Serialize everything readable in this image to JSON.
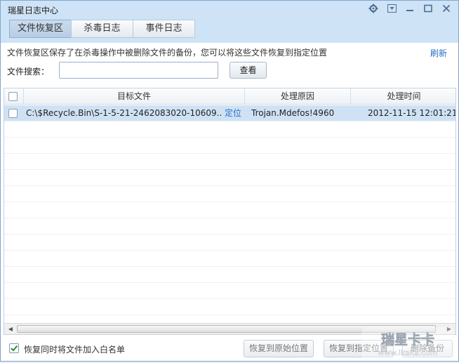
{
  "window": {
    "title": "瑞星日志中心"
  },
  "tabs": [
    {
      "label": "文件恢复区",
      "active": true
    },
    {
      "label": "杀毒日志",
      "active": false
    },
    {
      "label": "事件日志",
      "active": false
    }
  ],
  "info": {
    "text": "文件恢复区保存了在杀毒操作中被删除文件的备份，您可以将这些文件恢复到指定位置",
    "refresh_label": "刷新"
  },
  "search": {
    "label": "文件搜索：",
    "value": "",
    "button_label": "查看"
  },
  "table": {
    "columns": [
      "目标文件",
      "处理原因",
      "处理时间"
    ],
    "rows": [
      {
        "file": "C:\\$Recycle.Bin\\S-1-5-21-2462083020-10609...",
        "locate_label": "定位",
        "reason": "Trojan.Mdefos!4960",
        "time": "2012-11-15 12:01:21",
        "selected": true,
        "checked": false
      }
    ]
  },
  "footer": {
    "whitelist_label": "恢复同时将文件加入白名单",
    "whitelist_checked": true,
    "restore_original_label": "恢复到原始位置",
    "restore_to_label": "恢复到指定位置",
    "delete_label": "删除备份"
  },
  "watermark": {
    "text": "瑞星卡卡",
    "url": "www.ikaka.com"
  },
  "colors": {
    "accent": "#2a6fc4",
    "selected_row": "#cfe2f5",
    "title_bg": "#cfe3f6"
  }
}
